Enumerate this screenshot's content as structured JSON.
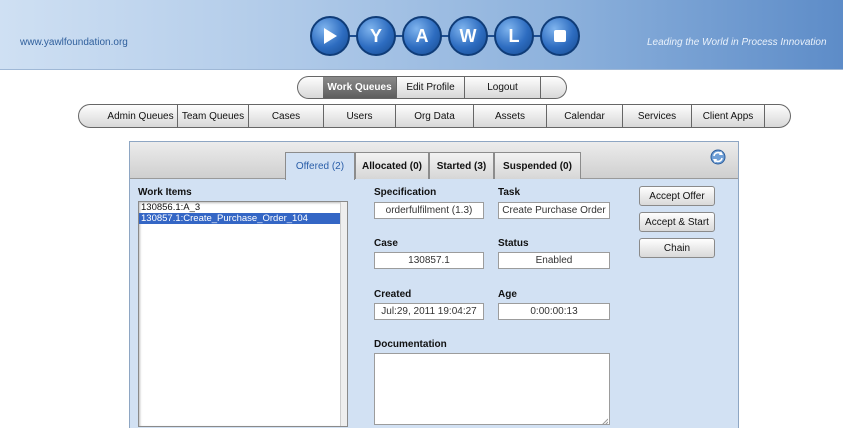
{
  "banner": {
    "site_url": "www.yawlfoundation.org",
    "tagline": "Leading the World in Process Innovation",
    "logo_letters": [
      "Y",
      "A",
      "W",
      "L"
    ]
  },
  "top_nav": {
    "items": [
      {
        "label": "Work Queues",
        "active": true
      },
      {
        "label": "Edit Profile",
        "active": false
      },
      {
        "label": "Logout",
        "active": false
      }
    ]
  },
  "admin_nav": {
    "items": [
      {
        "label": "Admin Queues"
      },
      {
        "label": "Team Queues"
      },
      {
        "label": "Cases"
      },
      {
        "label": "Users"
      },
      {
        "label": "Org Data"
      },
      {
        "label": "Assets"
      },
      {
        "label": "Calendar"
      },
      {
        "label": "Services"
      },
      {
        "label": "Client Apps"
      }
    ]
  },
  "tabs": [
    {
      "label": "Offered (2)",
      "active": true
    },
    {
      "label": "Allocated (0)",
      "active": false
    },
    {
      "label": "Started (3)",
      "active": false
    },
    {
      "label": "Suspended (0)",
      "active": false
    }
  ],
  "work_items": {
    "label": "Work Items",
    "items": [
      {
        "text": "130856.1:A_3",
        "selected": false
      },
      {
        "text": "130857.1:Create_Purchase_Order_104",
        "selected": true
      }
    ]
  },
  "details": {
    "specification": {
      "label": "Specification",
      "value": "orderfulfilment (1.3)"
    },
    "task": {
      "label": "Task",
      "value": "Create Purchase Order"
    },
    "case": {
      "label": "Case",
      "value": "130857.1"
    },
    "status": {
      "label": "Status",
      "value": "Enabled"
    },
    "created": {
      "label": "Created",
      "value": "Jul:29, 2011 19:04:27"
    },
    "age": {
      "label": "Age",
      "value": "0:00:00:13"
    },
    "documentation": {
      "label": "Documentation",
      "value": ""
    }
  },
  "actions": {
    "accept_offer": "Accept Offer",
    "accept_start": "Accept & Start",
    "chain": "Chain"
  },
  "colors": {
    "panel_bg": "#d2e1f3",
    "active_tab_text": "#2a5ea8",
    "selected_row": "#3466c5",
    "logo_blue": "#2d6cc0"
  }
}
